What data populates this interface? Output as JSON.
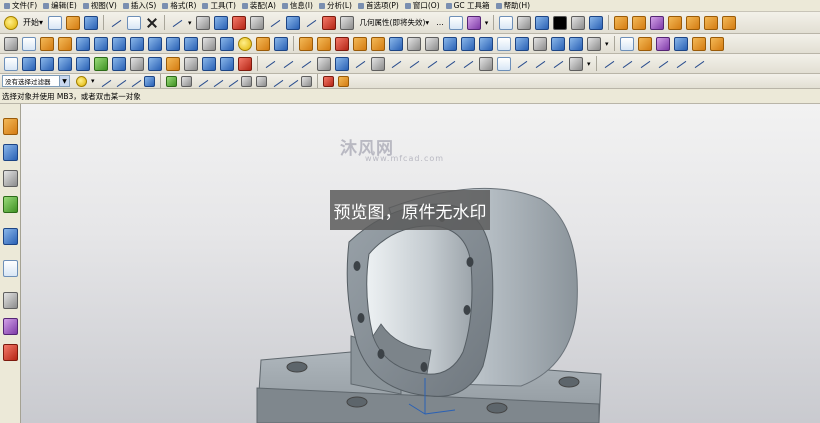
{
  "menubar": {
    "items": [
      "文件(F)",
      "编辑(E)",
      "视图(V)",
      "插入(S)",
      "格式(R)",
      "工具(T)",
      "装配(A)",
      "信息(I)",
      "分析(L)",
      "首选项(P)",
      "窗口(O)",
      "GC 工具箱",
      "帮助(H)"
    ]
  },
  "toolbar1": {
    "start_label": "开始▾",
    "history_mode_label": "几何属性(即将失效)▾",
    "ellipsis": "..."
  },
  "selection": {
    "filter_value": "没有选择过滤器"
  },
  "status": {
    "prompt": "选择对象并使用 MB3，或者双击某一对象"
  },
  "viewport": {
    "watermark_logo": "沐风网",
    "watermark_url": "www.mfcad.com",
    "preview_banner": "预览图，原件无水印"
  },
  "colors": {
    "accent_blue": "#2a61b5",
    "model_surface": "#a9b1b8",
    "banner_bg": "#5a5a5a"
  }
}
